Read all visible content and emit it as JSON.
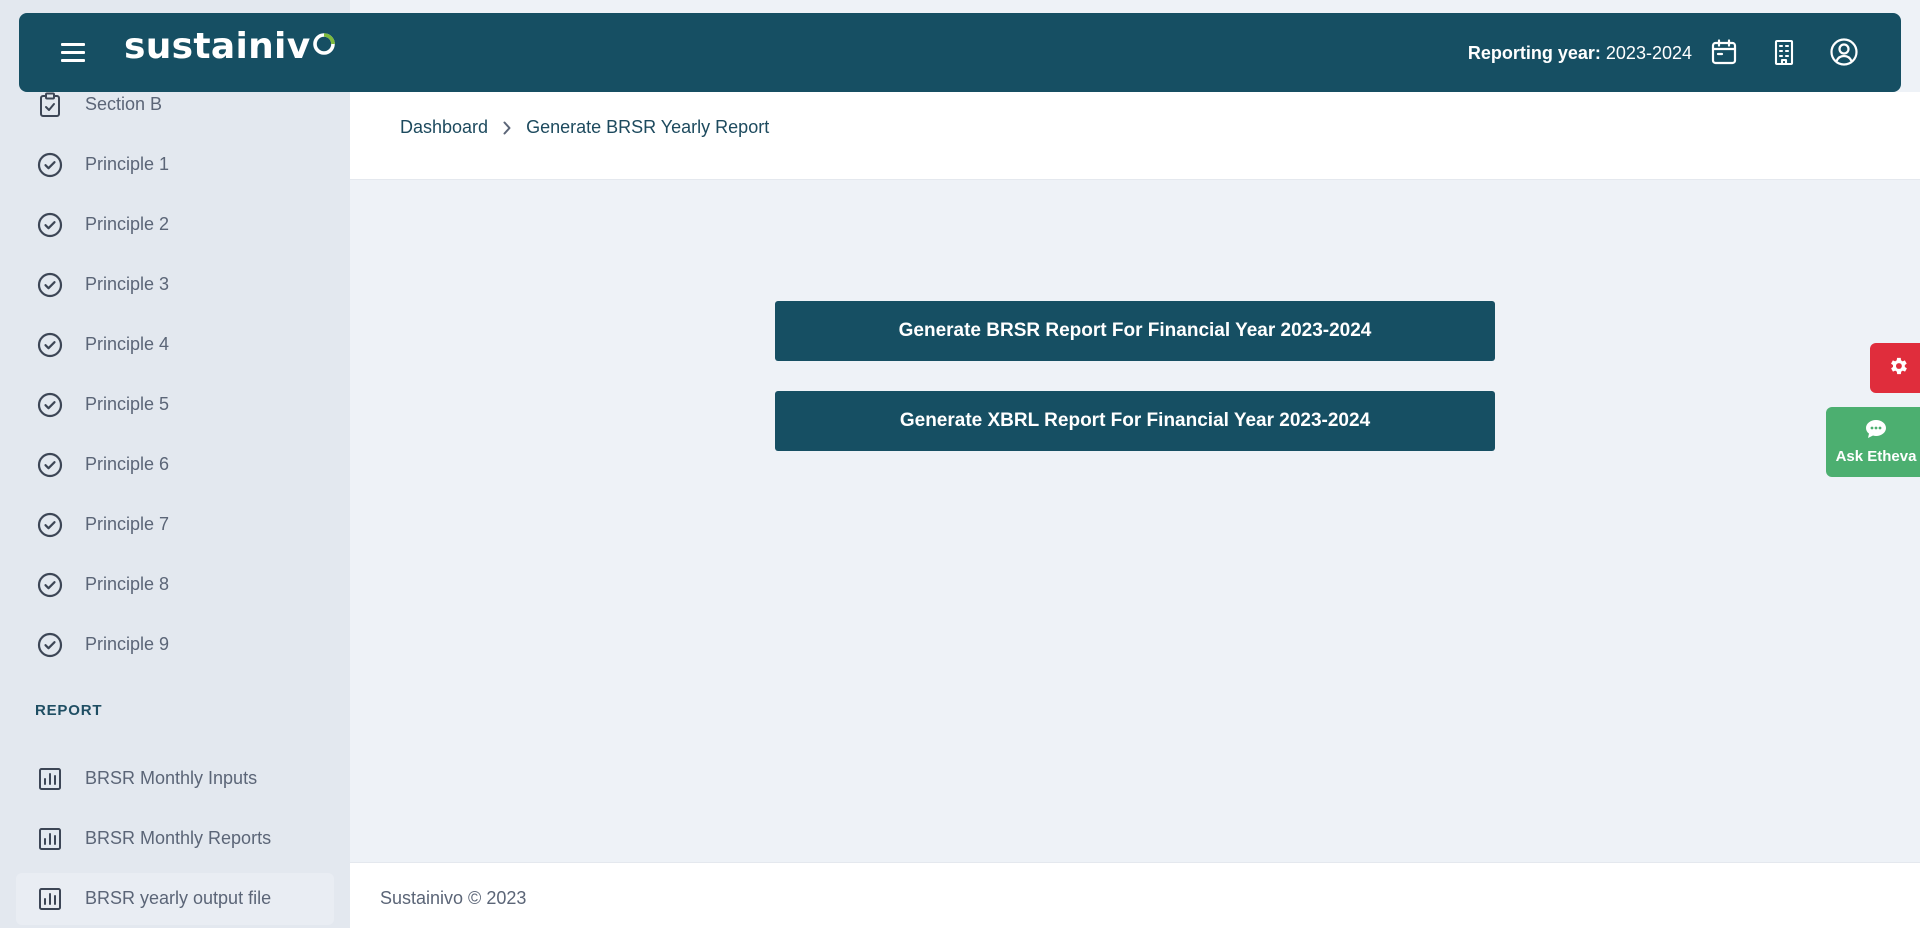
{
  "header": {
    "logo_text": "sustainiv",
    "logo_last": "o",
    "reporting_year_label": "Reporting year:",
    "reporting_year_value": "2023-2024",
    "colors": {
      "background": "#164f63",
      "logo_accent": "#7dbb3c"
    }
  },
  "sidebar": {
    "items": [
      {
        "label": "Section B",
        "icon": "clipboard-check-icon"
      },
      {
        "label": "Principle 1",
        "icon": "check-circle-icon"
      },
      {
        "label": "Principle 2",
        "icon": "check-circle-icon"
      },
      {
        "label": "Principle 3",
        "icon": "check-circle-icon"
      },
      {
        "label": "Principle 4",
        "icon": "check-circle-icon"
      },
      {
        "label": "Principle 5",
        "icon": "check-circle-icon"
      },
      {
        "label": "Principle 6",
        "icon": "check-circle-icon"
      },
      {
        "label": "Principle 7",
        "icon": "check-circle-icon"
      },
      {
        "label": "Principle 8",
        "icon": "check-circle-icon"
      },
      {
        "label": "Principle 9",
        "icon": "check-circle-icon"
      }
    ],
    "report_heading": "REPORT",
    "report_items": [
      {
        "label": "BRSR Monthly Inputs",
        "icon": "bar-chart-icon"
      },
      {
        "label": "BRSR Monthly Reports",
        "icon": "bar-chart-icon"
      },
      {
        "label": "BRSR yearly output file",
        "icon": "bar-chart-icon",
        "active": true
      }
    ]
  },
  "breadcrumb": {
    "home": "Dashboard",
    "current": "Generate BRSR Yearly Report"
  },
  "main": {
    "brsr_button": "Generate BRSR Report For Financial Year 2023-2024",
    "xbrl_button": "Generate XBRL Report For Financial Year 2023-2024"
  },
  "widgets": {
    "ask_label": "Ask Etheva",
    "settings_color": "#e02d3c",
    "ask_color": "#4caf70"
  },
  "footer": {
    "text": "Sustainivo © 2023"
  }
}
